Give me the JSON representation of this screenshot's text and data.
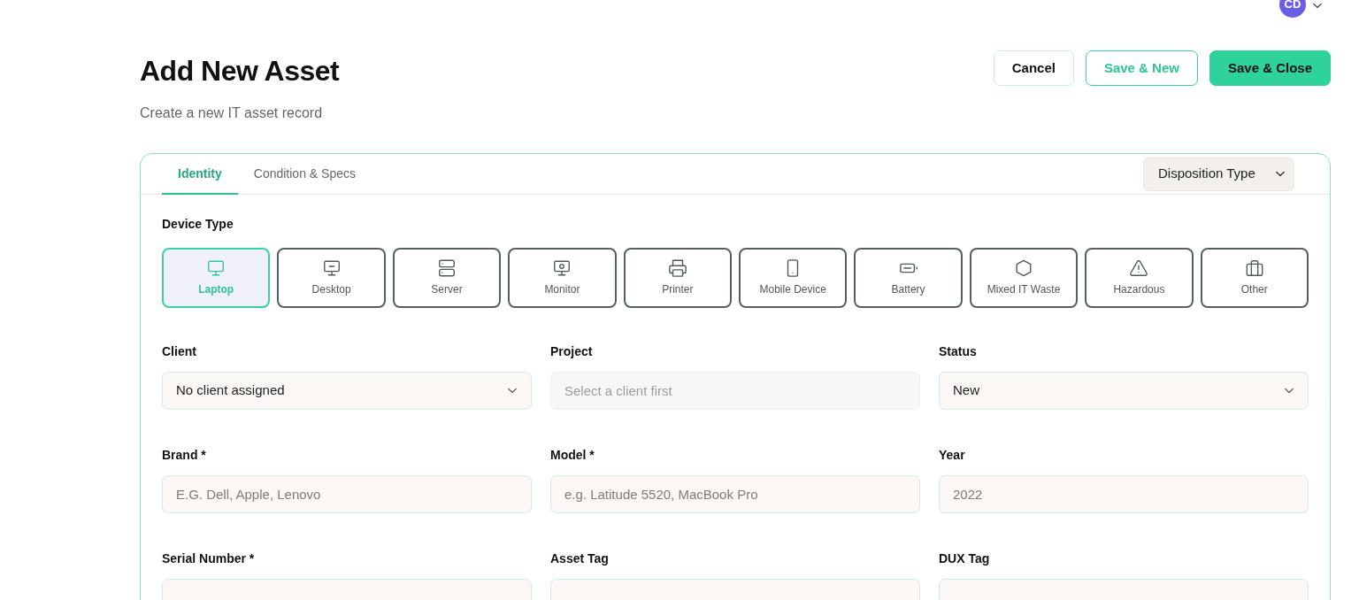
{
  "user_menu": {
    "initials": "CD"
  },
  "header": {
    "title": "Add New Asset",
    "subtitle": "Create a new IT asset record"
  },
  "actions": [
    {
      "label": "Cancel",
      "kind": "outline"
    },
    {
      "label": "Save & New",
      "kind": "accent-outline"
    },
    {
      "label": "Save & Close",
      "kind": "primary"
    }
  ],
  "tabs": [
    {
      "label": "Identity",
      "selected": true
    },
    {
      "label": "Condition & Specs",
      "selected": false
    }
  ],
  "disposition_select": {
    "value": "Disposition Type"
  },
  "device_type": {
    "label": "Device Type",
    "options": [
      {
        "label": "Laptop",
        "kind": "laptop",
        "selected": true
      },
      {
        "label": "Desktop",
        "kind": "desktop",
        "selected": false
      },
      {
        "label": "Server",
        "kind": "server",
        "selected": false
      },
      {
        "label": "Monitor",
        "kind": "monitor",
        "selected": false
      },
      {
        "label": "Printer",
        "kind": "printer",
        "selected": false
      },
      {
        "label": "Mobile Device",
        "kind": "mobile",
        "selected": false
      },
      {
        "label": "Battery",
        "kind": "battery",
        "selected": false
      },
      {
        "label": "Mixed IT Waste",
        "kind": "mixed",
        "selected": false
      },
      {
        "label": "Hazardous",
        "kind": "hazardous",
        "selected": false
      },
      {
        "label": "Other",
        "kind": "other",
        "selected": false
      }
    ]
  },
  "fields": [
    {
      "label": "Client",
      "kind": "select",
      "value": "No client assigned",
      "disabled": false
    },
    {
      "label": "Project",
      "kind": "input",
      "placeholder": "Select a client first",
      "disabled": true
    },
    {
      "label": "Status",
      "kind": "select",
      "value": "New",
      "disabled": false
    },
    {
      "label": "Brand *",
      "kind": "input",
      "placeholder": "E.G. Dell, Apple, Lenovo",
      "disabled": false
    },
    {
      "label": "Model *",
      "kind": "input",
      "placeholder": "e.g. Latitude 5520, MacBook Pro",
      "disabled": false
    },
    {
      "label": "Year",
      "kind": "input",
      "placeholder": "2022",
      "disabled": false
    },
    {
      "label": "Serial Number *",
      "kind": "input",
      "disabled": false
    },
    {
      "label": "Asset Tag",
      "kind": "input",
      "disabled": false
    },
    {
      "label": "DUX Tag",
      "kind": "input",
      "disabled": false
    }
  ]
}
